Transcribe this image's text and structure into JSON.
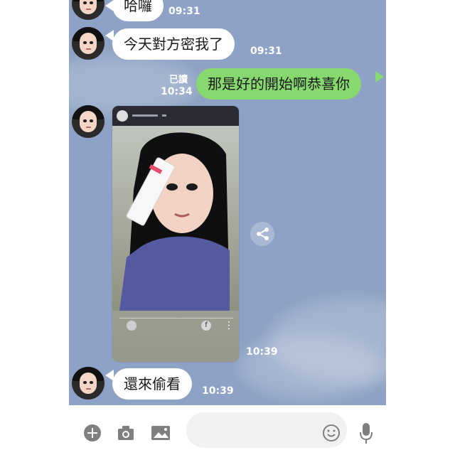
{
  "chat": {
    "messages": [
      {
        "text": "哈囉",
        "time": "09:31"
      },
      {
        "text": "今天對方密我了",
        "time": "09:31"
      },
      {
        "text": "那是好的開始啊恭喜你",
        "time": "10:34",
        "read": "已讀"
      },
      {
        "time": "10:39"
      },
      {
        "text": "還來偷看",
        "time": "10:39"
      }
    ]
  },
  "icons": {
    "add": "plus-circle-icon",
    "camera": "camera-icon",
    "gallery": "image-icon",
    "emoji": "emoji-icon",
    "mic": "microphone-icon",
    "share": "share-icon"
  },
  "colors": {
    "chat_background": "#8da2c4",
    "sent_bubble": "#86d86f",
    "received_bubble": "#ffffff",
    "icon_gray": "#7f7f7f"
  }
}
